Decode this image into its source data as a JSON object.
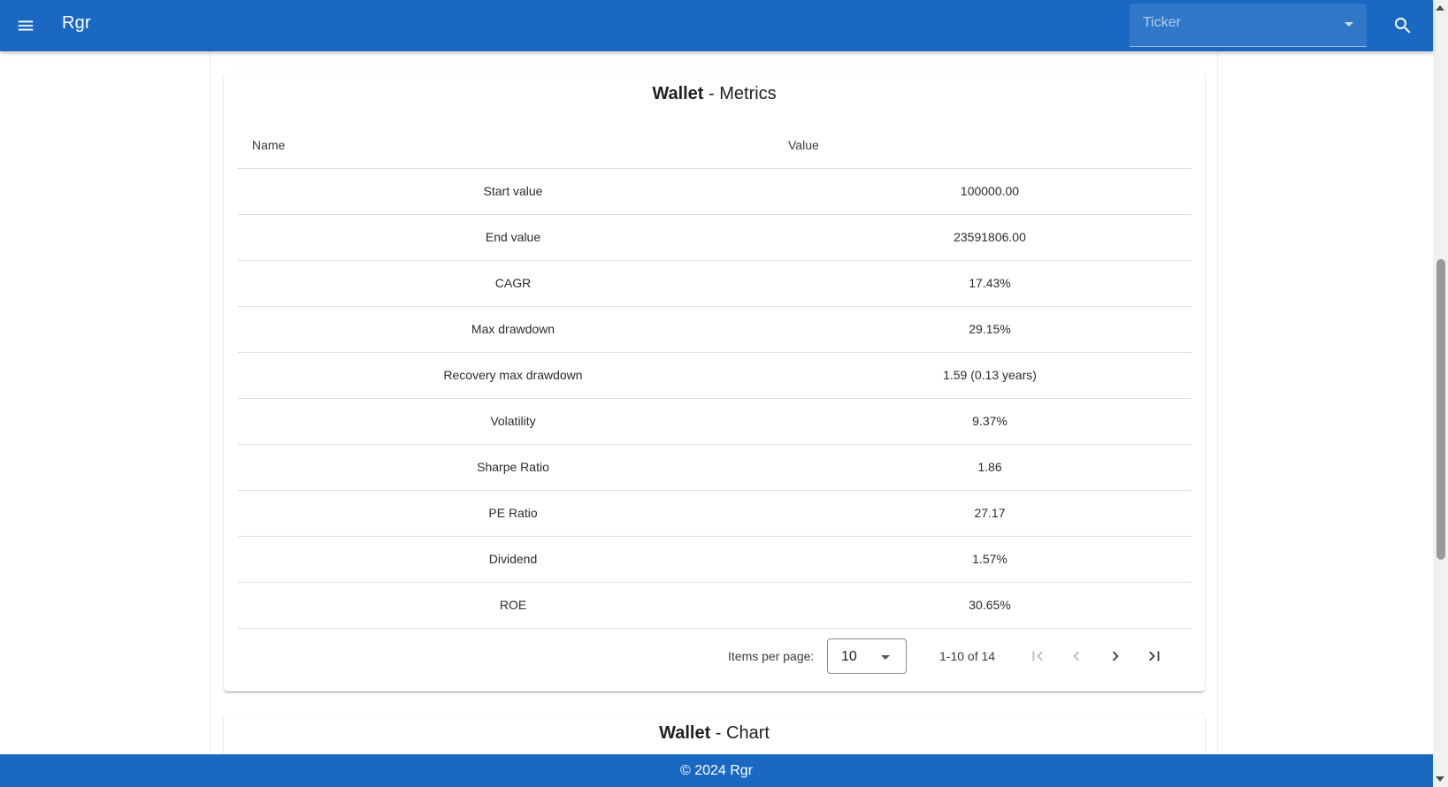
{
  "header": {
    "title": "Rgr",
    "ticker_placeholder": "Ticker",
    "menu_icon": "menu-icon",
    "search_icon": "search-icon",
    "bg_color": "#1a68c2"
  },
  "metrics_card": {
    "title_strong": "Wallet",
    "title_rest": " - Metrics",
    "columns": {
      "name": "Name",
      "value": "Value"
    },
    "rows": [
      {
        "name": "Start value",
        "value": "100000.00"
      },
      {
        "name": "End value",
        "value": "23591806.00"
      },
      {
        "name": "CAGR",
        "value": "17.43%"
      },
      {
        "name": "Max drawdown",
        "value": "29.15%"
      },
      {
        "name": "Recovery max drawdown",
        "value": "1.59 (0.13 years)"
      },
      {
        "name": "Volatility",
        "value": "9.37%"
      },
      {
        "name": "Sharpe Ratio",
        "value": "1.86"
      },
      {
        "name": "PE Ratio",
        "value": "27.17"
      },
      {
        "name": "Dividend",
        "value": "1.57%"
      },
      {
        "name": "ROE",
        "value": "30.65%"
      }
    ],
    "paginator": {
      "items_per_page_label": "Items per page:",
      "items_per_page_value": "10",
      "range_label": "1-10 of 14"
    }
  },
  "chart_card": {
    "title_strong": "Wallet",
    "title_rest": " - Chart"
  },
  "footer": {
    "text": "© 2024 Rgr"
  }
}
